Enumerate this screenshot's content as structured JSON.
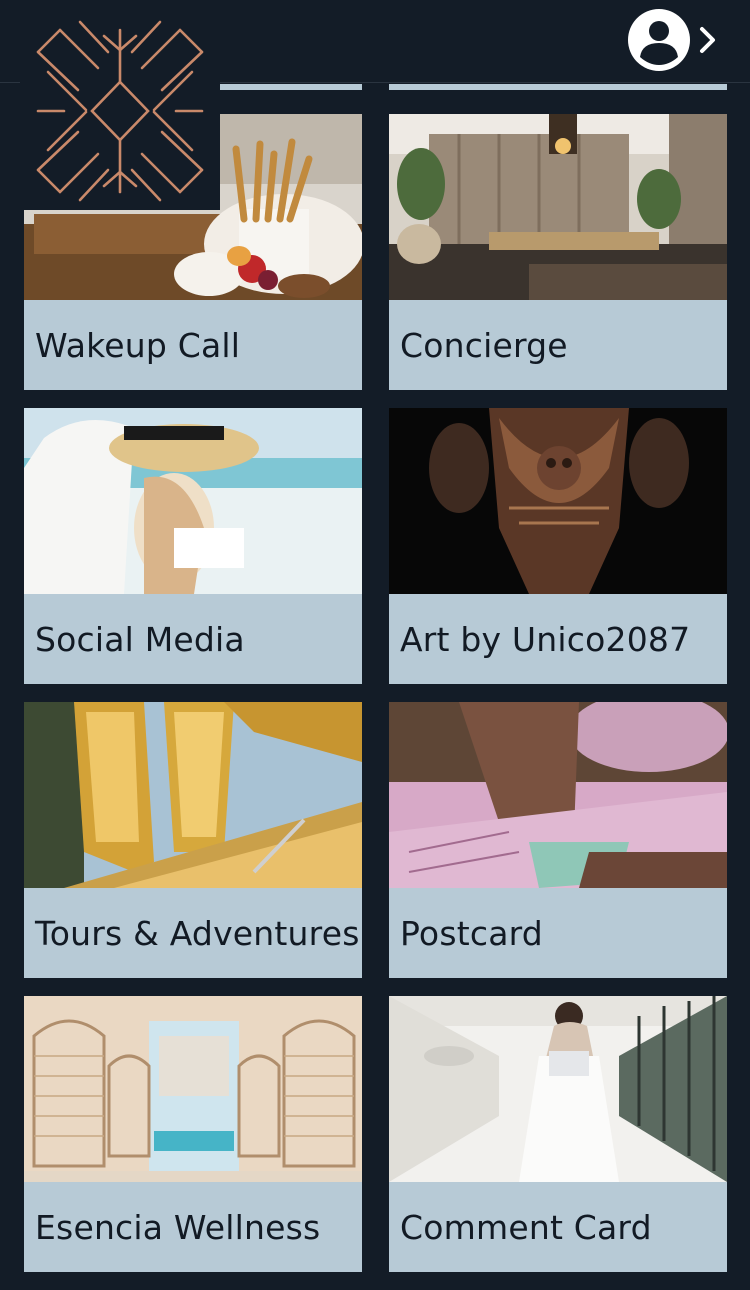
{
  "header": {
    "logo": "resort-logo",
    "profile_icon": "user-circle-icon",
    "chevron_icon": "chevron-right-icon"
  },
  "tiles": [
    {
      "label": "Wakeup Call",
      "image": "breakfast-tray-photo"
    },
    {
      "label": "Concierge",
      "image": "lobby-lounge-photo"
    },
    {
      "label": "Social Media",
      "image": "beach-hat-woman-photo"
    },
    {
      "label": "Art by Unico2087",
      "image": "wooden-sculpture-photo"
    },
    {
      "label": "Tours & Adventures",
      "image": "yellow-canoes-photo"
    },
    {
      "label": "Postcard",
      "image": "embroidery-hands-photo"
    },
    {
      "label": "Esencia Wellness",
      "image": "hanging-chairs-spa-photo"
    },
    {
      "label": "Comment Card",
      "image": "white-dress-woman-photo"
    }
  ],
  "colors": {
    "background": "#131c27",
    "tile_label_bg": "#b7cad6",
    "logo_stroke": "#c9896a",
    "text": "#121a24"
  }
}
